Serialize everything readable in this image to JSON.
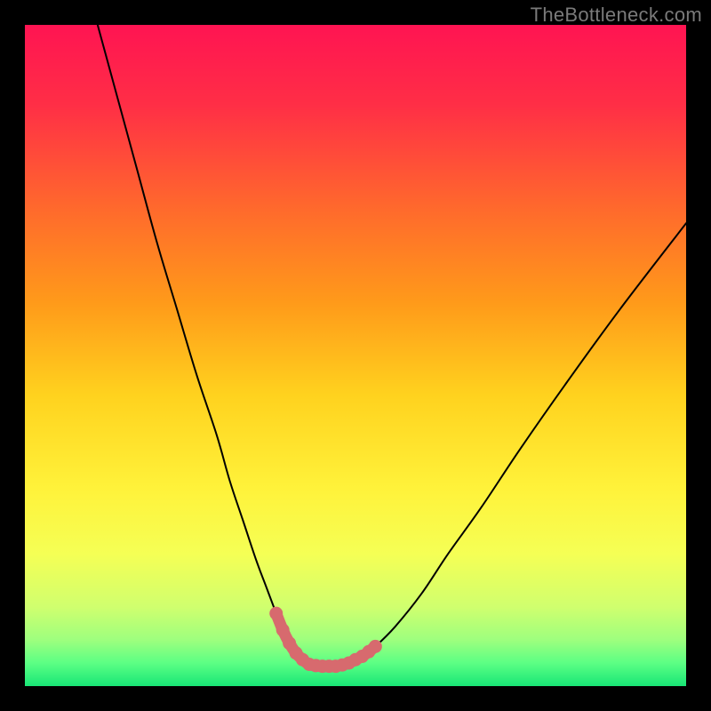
{
  "watermark": "TheBottleneck.com",
  "chart_data": {
    "type": "line",
    "title": "",
    "xlabel": "",
    "ylabel": "",
    "xlim": [
      0,
      100
    ],
    "ylim": [
      0,
      100
    ],
    "grid": false,
    "series": [
      {
        "name": "curve",
        "color": "#000000",
        "x": [
          11,
          14,
          17,
          20,
          23,
          26,
          29,
          31,
          33,
          35,
          36.5,
          38,
          39,
          40,
          41,
          42,
          43.5,
          45,
          47,
          49,
          51,
          53,
          56,
          60,
          64,
          69,
          75,
          82,
          90,
          100
        ],
        "y": [
          100,
          89,
          78,
          67,
          57,
          47,
          38,
          31,
          25,
          19,
          15,
          11,
          8.5,
          6.5,
          5,
          4,
          3.2,
          3,
          3,
          3.5,
          4.5,
          6,
          9,
          14,
          20,
          27,
          36,
          46,
          57,
          70
        ]
      },
      {
        "name": "highlight",
        "color": "#d76a6e",
        "x": [
          38,
          39,
          40,
          41,
          42,
          43,
          44,
          45,
          46,
          47,
          48,
          49,
          50,
          51,
          52,
          53
        ],
        "y": [
          11,
          8.5,
          6.5,
          5,
          4,
          3.3,
          3.1,
          3,
          3,
          3,
          3.2,
          3.5,
          4,
          4.5,
          5.2,
          6
        ]
      }
    ],
    "background": {
      "type": "vertical-gradient",
      "stops": [
        {
          "offset": 0.0,
          "color": "#ff1452"
        },
        {
          "offset": 0.12,
          "color": "#ff2e46"
        },
        {
          "offset": 0.28,
          "color": "#ff6a2c"
        },
        {
          "offset": 0.42,
          "color": "#ff9a1a"
        },
        {
          "offset": 0.56,
          "color": "#ffd21e"
        },
        {
          "offset": 0.7,
          "color": "#fff23a"
        },
        {
          "offset": 0.8,
          "color": "#f5ff55"
        },
        {
          "offset": 0.88,
          "color": "#d0ff6e"
        },
        {
          "offset": 0.93,
          "color": "#9eff7e"
        },
        {
          "offset": 0.965,
          "color": "#5cff84"
        },
        {
          "offset": 1.0,
          "color": "#18e676"
        }
      ]
    }
  }
}
